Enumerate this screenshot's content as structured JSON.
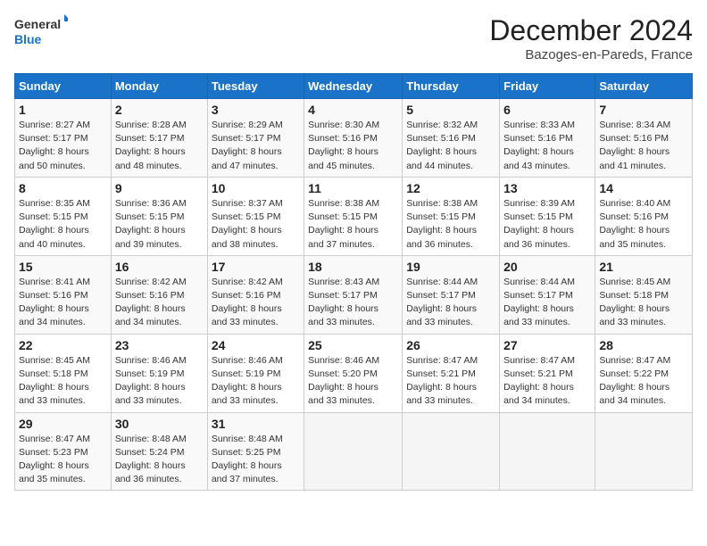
{
  "logo": {
    "line1": "General",
    "line2": "Blue"
  },
  "title": "December 2024",
  "subtitle": "Bazoges-en-Pareds, France",
  "headers": [
    "Sunday",
    "Monday",
    "Tuesday",
    "Wednesday",
    "Thursday",
    "Friday",
    "Saturday"
  ],
  "weeks": [
    [
      {
        "day": "1",
        "info": "Sunrise: 8:27 AM\nSunset: 5:17 PM\nDaylight: 8 hours\nand 50 minutes."
      },
      {
        "day": "2",
        "info": "Sunrise: 8:28 AM\nSunset: 5:17 PM\nDaylight: 8 hours\nand 48 minutes."
      },
      {
        "day": "3",
        "info": "Sunrise: 8:29 AM\nSunset: 5:17 PM\nDaylight: 8 hours\nand 47 minutes."
      },
      {
        "day": "4",
        "info": "Sunrise: 8:30 AM\nSunset: 5:16 PM\nDaylight: 8 hours\nand 45 minutes."
      },
      {
        "day": "5",
        "info": "Sunrise: 8:32 AM\nSunset: 5:16 PM\nDaylight: 8 hours\nand 44 minutes."
      },
      {
        "day": "6",
        "info": "Sunrise: 8:33 AM\nSunset: 5:16 PM\nDaylight: 8 hours\nand 43 minutes."
      },
      {
        "day": "7",
        "info": "Sunrise: 8:34 AM\nSunset: 5:16 PM\nDaylight: 8 hours\nand 41 minutes."
      }
    ],
    [
      {
        "day": "8",
        "info": "Sunrise: 8:35 AM\nSunset: 5:15 PM\nDaylight: 8 hours\nand 40 minutes."
      },
      {
        "day": "9",
        "info": "Sunrise: 8:36 AM\nSunset: 5:15 PM\nDaylight: 8 hours\nand 39 minutes."
      },
      {
        "day": "10",
        "info": "Sunrise: 8:37 AM\nSunset: 5:15 PM\nDaylight: 8 hours\nand 38 minutes."
      },
      {
        "day": "11",
        "info": "Sunrise: 8:38 AM\nSunset: 5:15 PM\nDaylight: 8 hours\nand 37 minutes."
      },
      {
        "day": "12",
        "info": "Sunrise: 8:38 AM\nSunset: 5:15 PM\nDaylight: 8 hours\nand 36 minutes."
      },
      {
        "day": "13",
        "info": "Sunrise: 8:39 AM\nSunset: 5:15 PM\nDaylight: 8 hours\nand 36 minutes."
      },
      {
        "day": "14",
        "info": "Sunrise: 8:40 AM\nSunset: 5:16 PM\nDaylight: 8 hours\nand 35 minutes."
      }
    ],
    [
      {
        "day": "15",
        "info": "Sunrise: 8:41 AM\nSunset: 5:16 PM\nDaylight: 8 hours\nand 34 minutes."
      },
      {
        "day": "16",
        "info": "Sunrise: 8:42 AM\nSunset: 5:16 PM\nDaylight: 8 hours\nand 34 minutes."
      },
      {
        "day": "17",
        "info": "Sunrise: 8:42 AM\nSunset: 5:16 PM\nDaylight: 8 hours\nand 33 minutes."
      },
      {
        "day": "18",
        "info": "Sunrise: 8:43 AM\nSunset: 5:17 PM\nDaylight: 8 hours\nand 33 minutes."
      },
      {
        "day": "19",
        "info": "Sunrise: 8:44 AM\nSunset: 5:17 PM\nDaylight: 8 hours\nand 33 minutes."
      },
      {
        "day": "20",
        "info": "Sunrise: 8:44 AM\nSunset: 5:17 PM\nDaylight: 8 hours\nand 33 minutes."
      },
      {
        "day": "21",
        "info": "Sunrise: 8:45 AM\nSunset: 5:18 PM\nDaylight: 8 hours\nand 33 minutes."
      }
    ],
    [
      {
        "day": "22",
        "info": "Sunrise: 8:45 AM\nSunset: 5:18 PM\nDaylight: 8 hours\nand 33 minutes."
      },
      {
        "day": "23",
        "info": "Sunrise: 8:46 AM\nSunset: 5:19 PM\nDaylight: 8 hours\nand 33 minutes."
      },
      {
        "day": "24",
        "info": "Sunrise: 8:46 AM\nSunset: 5:19 PM\nDaylight: 8 hours\nand 33 minutes."
      },
      {
        "day": "25",
        "info": "Sunrise: 8:46 AM\nSunset: 5:20 PM\nDaylight: 8 hours\nand 33 minutes."
      },
      {
        "day": "26",
        "info": "Sunrise: 8:47 AM\nSunset: 5:21 PM\nDaylight: 8 hours\nand 33 minutes."
      },
      {
        "day": "27",
        "info": "Sunrise: 8:47 AM\nSunset: 5:21 PM\nDaylight: 8 hours\nand 34 minutes."
      },
      {
        "day": "28",
        "info": "Sunrise: 8:47 AM\nSunset: 5:22 PM\nDaylight: 8 hours\nand 34 minutes."
      }
    ],
    [
      {
        "day": "29",
        "info": "Sunrise: 8:47 AM\nSunset: 5:23 PM\nDaylight: 8 hours\nand 35 minutes."
      },
      {
        "day": "30",
        "info": "Sunrise: 8:48 AM\nSunset: 5:24 PM\nDaylight: 8 hours\nand 36 minutes."
      },
      {
        "day": "31",
        "info": "Sunrise: 8:48 AM\nSunset: 5:25 PM\nDaylight: 8 hours\nand 37 minutes."
      },
      {
        "day": "",
        "info": ""
      },
      {
        "day": "",
        "info": ""
      },
      {
        "day": "",
        "info": ""
      },
      {
        "day": "",
        "info": ""
      }
    ]
  ]
}
